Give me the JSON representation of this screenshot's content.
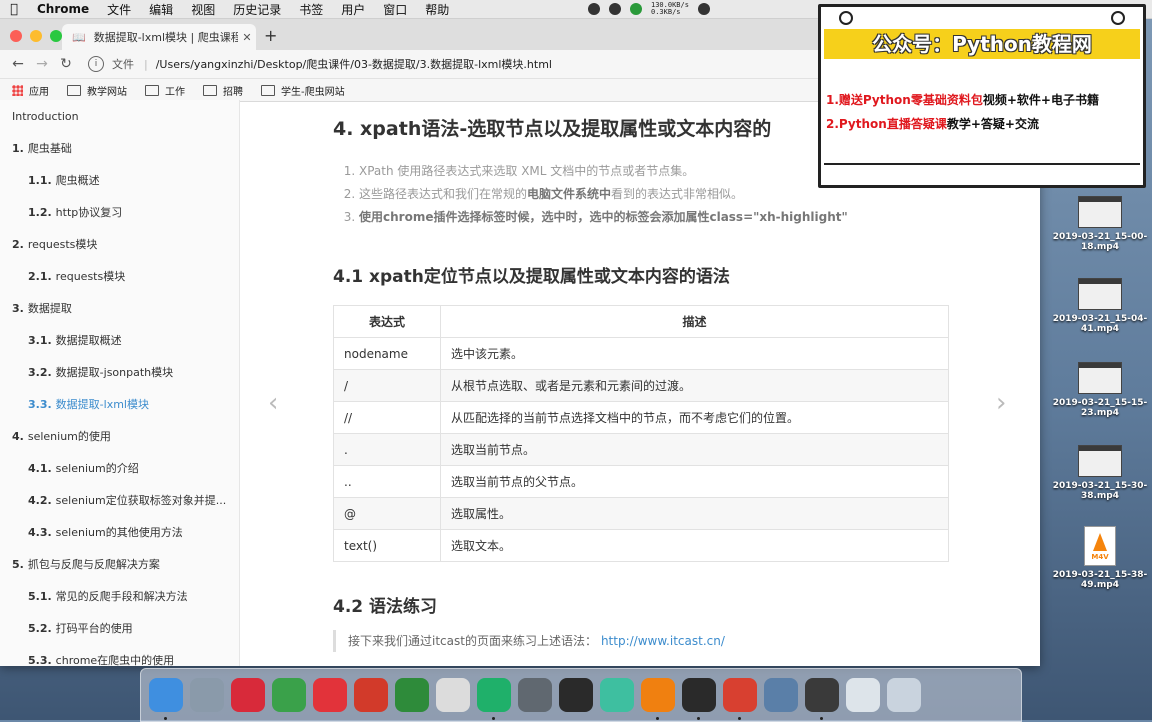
{
  "menubar": {
    "items": [
      "Chrome",
      "文件",
      "编辑",
      "视图",
      "历史记录",
      "书签",
      "用户",
      "窗口",
      "帮助"
    ],
    "net_up": "130.0KB/s",
    "net_down": "0.3KB/s"
  },
  "browser": {
    "tab_title": "数据提取-lxml模块 | 爬虫课程概",
    "address_scheme": "文件",
    "address_path": "/Users/yangxinzhi/Desktop/爬虫课件/03-数据提取/3.数据提取-lxml模块.html",
    "bookmarks": [
      "应用",
      "教学网站",
      "工作",
      "招聘",
      "学生-爬虫网站"
    ]
  },
  "sidebar": {
    "items": [
      {
        "num": "",
        "label": "Introduction",
        "level": 1
      },
      {
        "num": "1.",
        "label": "爬虫基础",
        "level": 1
      },
      {
        "num": "1.1.",
        "label": "爬虫概述",
        "level": 2
      },
      {
        "num": "1.2.",
        "label": "http协议复习",
        "level": 2
      },
      {
        "num": "2.",
        "label": "requests模块",
        "level": 1
      },
      {
        "num": "2.1.",
        "label": "requests模块",
        "level": 2
      },
      {
        "num": "3.",
        "label": "数据提取",
        "level": 1
      },
      {
        "num": "3.1.",
        "label": "数据提取概述",
        "level": 2
      },
      {
        "num": "3.2.",
        "label": "数据提取-jsonpath模块",
        "level": 2
      },
      {
        "num": "3.3.",
        "label": "数据提取-lxml模块",
        "level": 2,
        "active": true
      },
      {
        "num": "4.",
        "label": "selenium的使用",
        "level": 1
      },
      {
        "num": "4.1.",
        "label": "selenium的介绍",
        "level": 2
      },
      {
        "num": "4.2.",
        "label": "selenium定位获取标签对象并提...",
        "level": 2
      },
      {
        "num": "4.3.",
        "label": "selenium的其他使用方法",
        "level": 2
      },
      {
        "num": "5.",
        "label": "抓包与反爬与反爬解决方案",
        "level": 1
      },
      {
        "num": "5.1.",
        "label": "常见的反爬手段和解决方法",
        "level": 2
      },
      {
        "num": "5.2.",
        "label": "打码平台的使用",
        "level": 2
      },
      {
        "num": "5.3.",
        "label": "chrome在爬虫中的使用",
        "level": 2
      }
    ]
  },
  "article": {
    "heading4": "4. xpath语法-选取节点以及提取属性或文本内容的",
    "notes": [
      {
        "pre": "XPath 使用路径表达式来选取 XML 文档中的节点或者节点集。",
        "bold": "",
        "post": ""
      },
      {
        "pre": "这些路径表达式和我们在常规的",
        "bold": "电脑文件系统中",
        "post": "看到的表达式非常相似。"
      },
      {
        "pre": "",
        "bold": "使用chrome插件选择标签时候，选中时，选中的标签会添加属性class=\"xh-highlight\"",
        "post": ""
      }
    ],
    "heading41": "4.1 xpath定位节点以及提取属性或文本内容的语法",
    "table": {
      "headers": [
        "表达式",
        "描述"
      ],
      "rows": [
        [
          "nodename",
          "选中该元素。"
        ],
        [
          "/",
          "从根节点选取、或者是元素和元素间的过渡。"
        ],
        [
          "//",
          "从匹配选择的当前节点选择文档中的节点，而不考虑它们的位置。"
        ],
        [
          ".",
          "选取当前节点。"
        ],
        [
          "..",
          "选取当前节点的父节点。"
        ],
        [
          "@",
          "选取属性。"
        ],
        [
          "text()",
          "选取文本。"
        ]
      ]
    },
    "heading42": "4.2 语法练习",
    "quote_text": "接下来我们通过itcast的页面来练习上述语法：",
    "quote_link": "http://www.itcast.cn/"
  },
  "ad": {
    "header": "公众号：Python教程网",
    "line1_red": "1.赠送Python零基础资料包",
    "line1_black": "视频+软件+电子书籍",
    "line2_red": "2.Python直播答疑课",
    "line2_black": "教学+答疑+交流"
  },
  "desktop_files": [
    {
      "name": "2019-03-21_15-00-18.mp4"
    },
    {
      "name": "2019-03-21_15-04-41.mp4"
    },
    {
      "name": "2019-03-21_15-15-23.mp4"
    },
    {
      "name": "2019-03-21_15-30-38.mp4"
    },
    {
      "name": "2019-03-21_15-38-49.mp4",
      "badge": "M4V"
    }
  ],
  "dock_colors": [
    "#3f8fe0",
    "#8a9aaa",
    "#d82a3a",
    "#3aa14a",
    "#e2333a",
    "#d23a2a",
    "#2e8b3a",
    "#dcdcdc",
    "#1fb06a",
    "#606870",
    "#2a2a2a",
    "#3ebfa0",
    "#f08010",
    "#2a2a2a",
    "#d84030",
    "#5a7fa8",
    "#3a3a3a",
    "#dde4ea",
    "#c9d3de"
  ]
}
